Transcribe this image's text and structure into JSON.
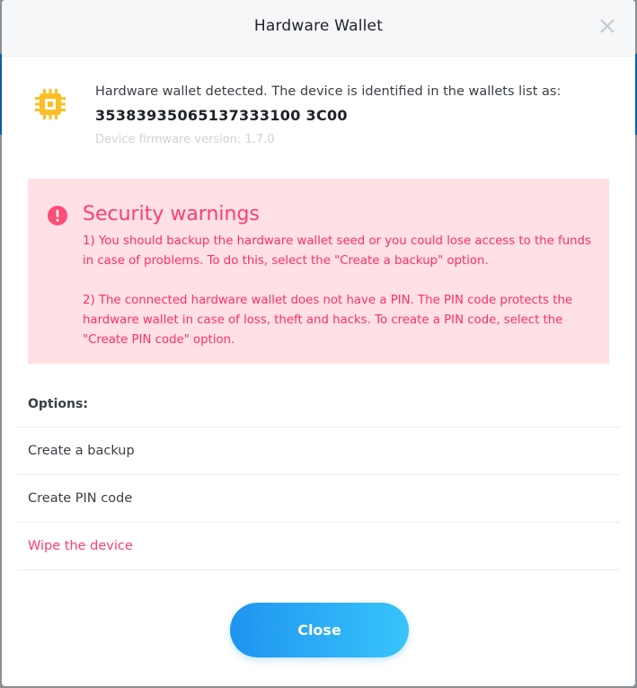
{
  "dialog": {
    "title": "Hardware Wallet",
    "close_icon": "close-x-icon"
  },
  "device": {
    "icon": "chip-icon",
    "detected_text": "Hardware wallet detected. The device is identified in the wallets list as:",
    "id": "35383935065137333100 3C00",
    "firmware_text": "Device firmware version: 1.7.0"
  },
  "warnings": {
    "icon": "exclamation-circle-icon",
    "title": "Security warnings",
    "items": [
      "1) You should backup the hardware wallet seed or you could lose access to the funds in case of problems. To do this, select the \"Create a backup\" option.",
      "2) The connected hardware wallet does not have a PIN. The PIN code protects the hardware wallet in case of loss, theft and hacks. To create a PIN code, select the \"Create PIN code\" option."
    ]
  },
  "options": {
    "label": "Options:",
    "items": [
      {
        "label": "Create a backup",
        "danger": false
      },
      {
        "label": "Create PIN code",
        "danger": false
      },
      {
        "label": "Wipe the device",
        "danger": true
      }
    ]
  },
  "footer": {
    "close_label": "Close"
  },
  "colors": {
    "accent_start": "#1f94f0",
    "accent_end": "#38c4fb",
    "warning_bg": "#ffe1e5",
    "warning_text": "#ff2f66",
    "chip_icon": "#fbbf24"
  }
}
